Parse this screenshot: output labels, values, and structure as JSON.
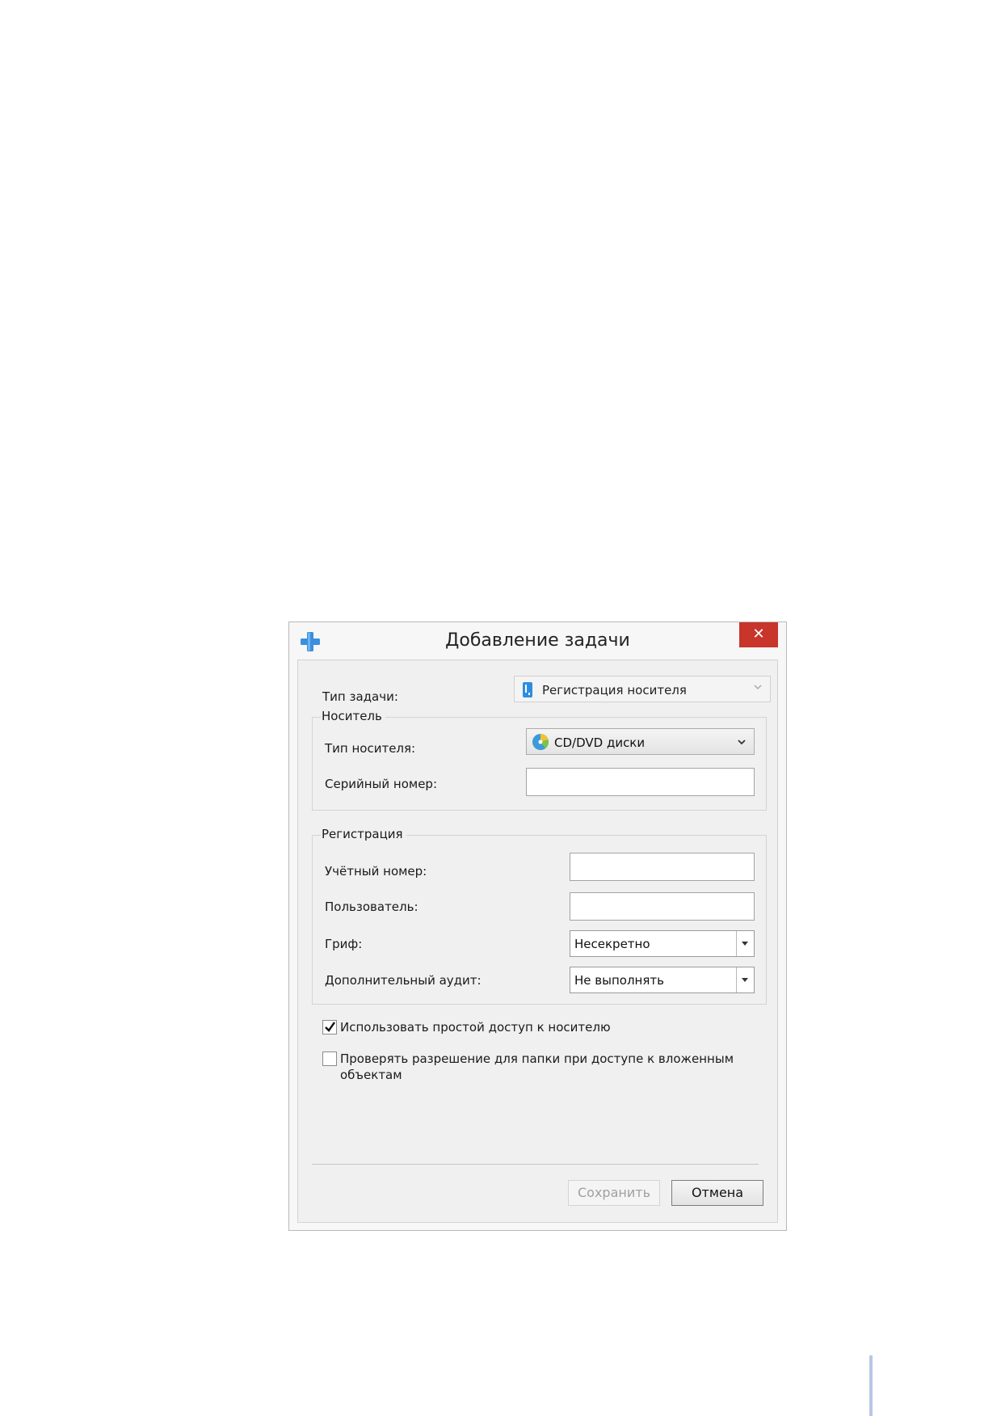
{
  "dialog": {
    "title": "Добавление задачи",
    "close_label": "✕"
  },
  "task_type": {
    "label": "Тип задачи:",
    "value": "Регистрация носителя"
  },
  "media_group": {
    "legend": "Носитель",
    "media_type_label": "Тип носителя:",
    "media_type_value": "CD/DVD диски",
    "serial_label": "Серийный номер:",
    "serial_value": ""
  },
  "registration_group": {
    "legend": "Регистрация",
    "account_label": "Учётный номер:",
    "account_value": "",
    "user_label": "Пользователь:",
    "user_value": "",
    "stamp_label": "Гриф:",
    "stamp_value": "Несекретно",
    "audit_label": "Дополнительный аудит:",
    "audit_value": "Не выполнять"
  },
  "options": {
    "simple_access_label": "Использовать простой доступ к носителю",
    "simple_access_checked": true,
    "check_folder_label_line1": "Проверять разрешение для папки при доступе к вложенным",
    "check_folder_label_line2": "объектам",
    "check_folder_checked": false
  },
  "buttons": {
    "save_label": "Сохранить",
    "cancel_label": "Отмена"
  },
  "colors": {
    "close_red": "#c7352b",
    "accent_blue": "#2f8de0"
  }
}
